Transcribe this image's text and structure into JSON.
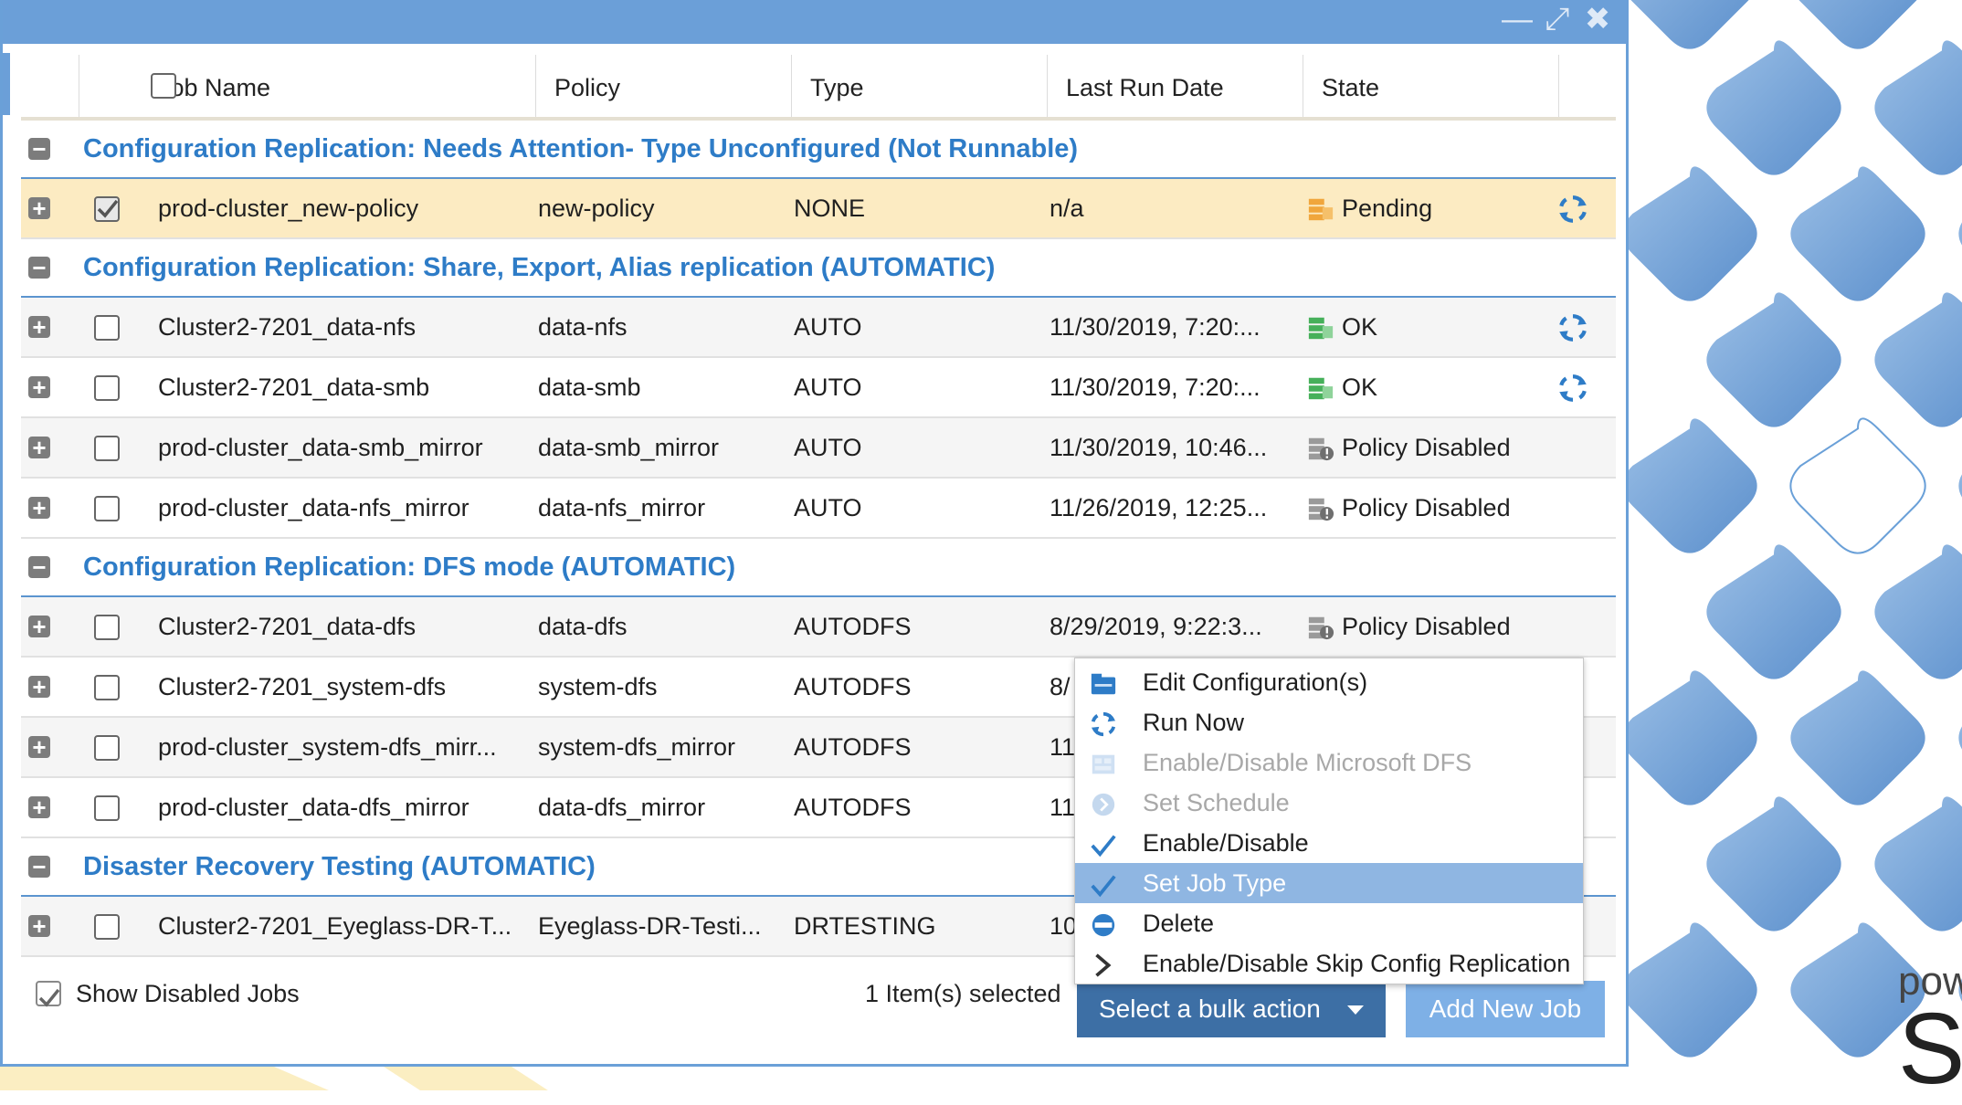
{
  "window": {
    "controls": [
      "minimize-icon",
      "maximize-icon",
      "close-icon"
    ]
  },
  "table": {
    "columns": {
      "job_name": "Job Name",
      "policy": "Policy",
      "type": "Type",
      "last_run_date": "Last Run Date",
      "state": "State"
    },
    "groups": [
      {
        "title": "Configuration Replication: Needs Attention- Type Unconfigured (Not Runnable)",
        "rows": [
          {
            "name": "prod-cluster_new-policy",
            "policy": "new-policy",
            "type": "NONE",
            "date": "n/a",
            "state": "Pending",
            "state_icon": "pending-icon",
            "checked": true,
            "selected": true,
            "runnable": true
          }
        ]
      },
      {
        "title": "Configuration Replication: Share, Export, Alias replication (AUTOMATIC)",
        "rows": [
          {
            "name": "Cluster2-7201_data-nfs",
            "policy": "data-nfs",
            "type": "AUTO",
            "date": "11/30/2019, 7:20:...",
            "state": "OK",
            "state_icon": "ok-icon",
            "checked": false,
            "runnable": true
          },
          {
            "name": "Cluster2-7201_data-smb",
            "policy": "data-smb",
            "type": "AUTO",
            "date": "11/30/2019, 7:20:...",
            "state": "OK",
            "state_icon": "ok-icon",
            "checked": false,
            "runnable": true
          },
          {
            "name": "prod-cluster_data-smb_mirror",
            "policy": "data-smb_mirror",
            "type": "AUTO",
            "date": "11/30/2019, 10:46...",
            "state": "Policy Disabled",
            "state_icon": "policy-disabled-icon",
            "checked": false,
            "runnable": false
          },
          {
            "name": "prod-cluster_data-nfs_mirror",
            "policy": "data-nfs_mirror",
            "type": "AUTO",
            "date": "11/26/2019, 12:25...",
            "state": "Policy Disabled",
            "state_icon": "policy-disabled-icon",
            "checked": false,
            "runnable": false
          }
        ]
      },
      {
        "title": "Configuration Replication: DFS mode (AUTOMATIC)",
        "rows": [
          {
            "name": "Cluster2-7201_data-dfs",
            "policy": "data-dfs",
            "type": "AUTODFS",
            "date": "8/29/2019, 9:22:3...",
            "state": "Policy Disabled",
            "state_icon": "policy-disabled-icon",
            "checked": false,
            "runnable": false
          },
          {
            "name": "Cluster2-7201_system-dfs",
            "policy": "system-dfs",
            "type": "AUTODFS",
            "date": "8/",
            "state": "",
            "checked": false,
            "runnable": false
          },
          {
            "name": "prod-cluster_system-dfs_mirr...",
            "policy": "system-dfs_mirror",
            "type": "AUTODFS",
            "date": "11",
            "state": "",
            "checked": false,
            "runnable": false
          },
          {
            "name": "prod-cluster_data-dfs_mirror",
            "policy": "data-dfs_mirror",
            "type": "AUTODFS",
            "date": "11",
            "state": "",
            "checked": false,
            "runnable": false
          }
        ]
      },
      {
        "title": "Disaster Recovery Testing (AUTOMATIC)",
        "rows": [
          {
            "name": "Cluster2-7201_Eyeglass-DR-T...",
            "policy": "Eyeglass-DR-Testi...",
            "type": "DRTESTING",
            "date": "10",
            "state": "",
            "checked": false,
            "runnable": false
          }
        ]
      }
    ]
  },
  "footer": {
    "show_disabled_label": "Show Disabled Jobs",
    "show_disabled_checked": true,
    "selection_count": "1 Item(s) selected",
    "bulk_action_label": "Select a bulk action",
    "add_new_job_label": "Add New Job"
  },
  "bulk_menu": {
    "items": [
      {
        "label": "Edit Configuration(s)",
        "icon": "edit-config-icon",
        "disabled": false,
        "highlighted": false
      },
      {
        "label": "Run Now",
        "icon": "run-now-icon",
        "disabled": false,
        "highlighted": false
      },
      {
        "label": "Enable/Disable Microsoft DFS",
        "icon": "dfs-icon",
        "disabled": true,
        "highlighted": false
      },
      {
        "label": "Set Schedule",
        "icon": "schedule-icon",
        "disabled": true,
        "highlighted": false
      },
      {
        "label": "Enable/Disable",
        "icon": "checkmark-icon",
        "disabled": false,
        "highlighted": false
      },
      {
        "label": "Set Job Type",
        "icon": "checkmark-icon",
        "disabled": false,
        "highlighted": true
      },
      {
        "label": "Delete",
        "icon": "delete-icon",
        "disabled": false,
        "highlighted": false
      },
      {
        "label": "Enable/Disable Skip Config Replication",
        "icon": "chevron-right-icon",
        "disabled": false,
        "highlighted": false
      }
    ]
  },
  "brand": {
    "small": "pow",
    "big": "SU"
  },
  "colors": {
    "accent": "#6b9fd8",
    "group_title": "#2e7cc7",
    "selected_row": "#fcebc2",
    "bulk_button": "#3d6fa5",
    "add_button": "#7eb0e6",
    "menu_highlight": "#8fb6e2"
  }
}
